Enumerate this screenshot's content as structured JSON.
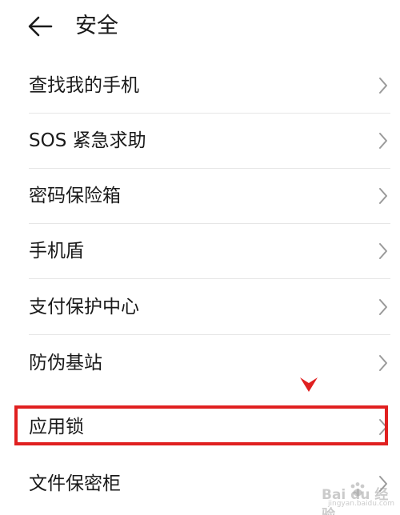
{
  "header": {
    "title": "安全",
    "back_icon": "arrow-left-icon"
  },
  "items": [
    {
      "label": "查找我的手机"
    },
    {
      "label": "SOS 紧急求助"
    },
    {
      "label": "密码保险箱"
    },
    {
      "label": "手机盾"
    },
    {
      "label": "支付保护中心"
    },
    {
      "label": "防伪基站"
    },
    {
      "label": "应用锁"
    },
    {
      "label": "文件保密柜"
    }
  ],
  "annotation": {
    "highlight_color": "#e02020",
    "highlighted_item": "应用锁"
  },
  "watermark": {
    "text": "Bai du 经验",
    "sub": "jingyan.baidu.com"
  },
  "colors": {
    "text": "#1a1a1a",
    "chevron": "#9a9a9a",
    "divider": "#e6e6e6",
    "background": "#ffffff"
  }
}
